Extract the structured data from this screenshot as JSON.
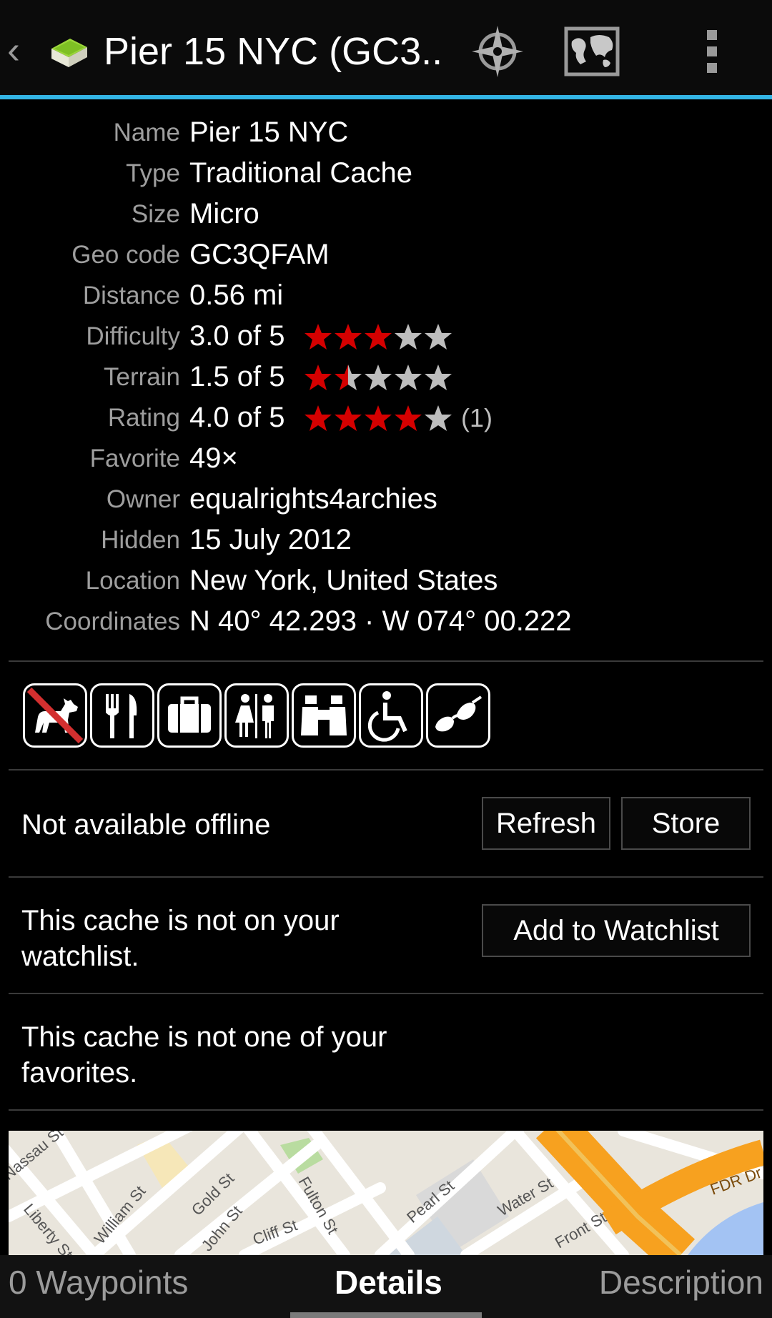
{
  "header": {
    "title": "Pier 15 NYC (GC3...",
    "icons": [
      "back-chevron-icon",
      "cache-box-icon",
      "compass-icon",
      "map-icon",
      "overflow-menu-icon"
    ]
  },
  "details": {
    "rows": [
      {
        "label": "Name",
        "value": "Pier 15 NYC"
      },
      {
        "label": "Type",
        "value": "Traditional Cache"
      },
      {
        "label": "Size",
        "value": "Micro"
      },
      {
        "label": "Geo code",
        "value": "GC3QFAM"
      },
      {
        "label": "Distance",
        "value": "0.56 mi"
      },
      {
        "label": "Difficulty",
        "value": "3.0 of 5",
        "stars": 3.0
      },
      {
        "label": "Terrain",
        "value": "1.5 of 5",
        "stars": 1.5
      },
      {
        "label": "Rating",
        "value": "4.0 of 5",
        "stars": 4.0,
        "count": "(1)"
      },
      {
        "label": "Favorite",
        "value": "49×"
      },
      {
        "label": "Owner",
        "value": "equalrights4archies"
      },
      {
        "label": "Hidden",
        "value": "15 July 2012"
      },
      {
        "label": "Location",
        "value": "New York, United States"
      },
      {
        "label": "Coordinates",
        "value": "N 40° 42.293 · W 074° 00.222"
      }
    ]
  },
  "attributes": [
    "no-dogs-icon",
    "restaurant-icon",
    "luggage-icon",
    "restrooms-icon",
    "binoculars-icon",
    "wheelchair-icon",
    "sunglasses-icon"
  ],
  "offline": {
    "status": "Not available offline",
    "refresh_label": "Refresh",
    "store_label": "Store"
  },
  "watchlist": {
    "status": "This cache is not on your watchlist.",
    "button_label": "Add to Watchlist"
  },
  "favorites": {
    "status": "This cache is not one of your favorites."
  },
  "map": {
    "streets": [
      "Nassau St",
      "Liberty St",
      "William St",
      "John St",
      "Gold St",
      "Cliff St",
      "Fulton St",
      "Pearl St",
      "Water St",
      "Front St",
      "FDR Dr"
    ]
  },
  "tabs": {
    "waypoints": "0 Waypoints",
    "details": "Details",
    "description": "Description"
  },
  "colors": {
    "accent": "#33b5e5",
    "star_on": "#d50000",
    "star_off": "#bdbdbd"
  }
}
